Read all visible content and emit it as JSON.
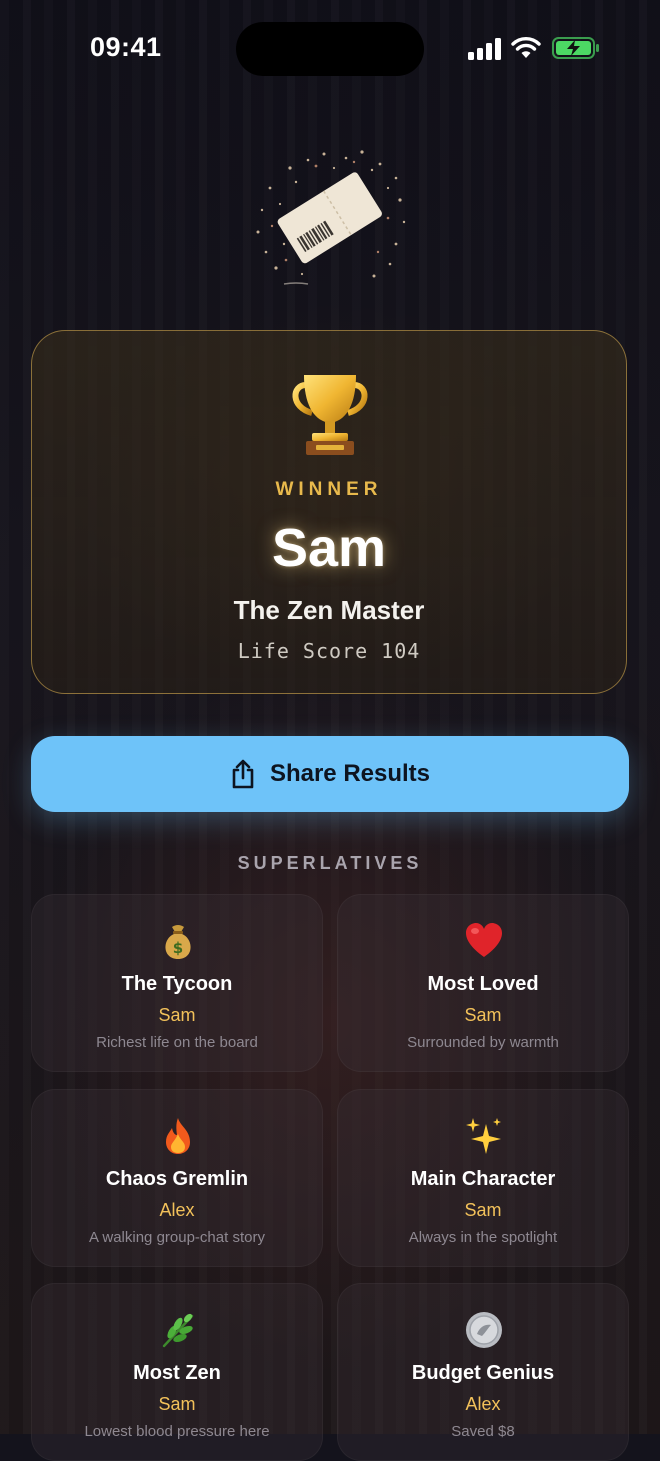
{
  "status_bar": {
    "time": "09:41",
    "battery": "charging"
  },
  "winner": {
    "label": "WINNER",
    "name": "Sam",
    "title": "The Zen Master",
    "score_text": "Life Score 104",
    "trophy_icon": "trophy-icon"
  },
  "share": {
    "label": "Share Results",
    "icon": "share-icon",
    "color": "#6ec3f9"
  },
  "superlatives": {
    "heading": "SUPERLATIVES",
    "items": [
      {
        "icon": "money-bag-icon",
        "title": "The Tycoon",
        "name": "Sam",
        "desc": "Richest life on the board"
      },
      {
        "icon": "heart-icon",
        "title": "Most Loved",
        "name": "Sam",
        "desc": "Surrounded by warmth"
      },
      {
        "icon": "fire-icon",
        "title": "Chaos Gremlin",
        "name": "Alex",
        "desc": "A walking group-chat story"
      },
      {
        "icon": "sparkles-icon",
        "title": "Main Character",
        "name": "Sam",
        "desc": "Always in the spotlight"
      },
      {
        "icon": "herb-icon",
        "title": "Most Zen",
        "name": "Sam",
        "desc": "Lowest blood pressure here"
      },
      {
        "icon": "coin-icon",
        "title": "Budget Genius",
        "name": "Alex",
        "desc": "Saved $8"
      }
    ]
  },
  "colors": {
    "accent_gold": "#e8b94c",
    "name_gold": "#f2c15a",
    "background": "#14131c"
  }
}
